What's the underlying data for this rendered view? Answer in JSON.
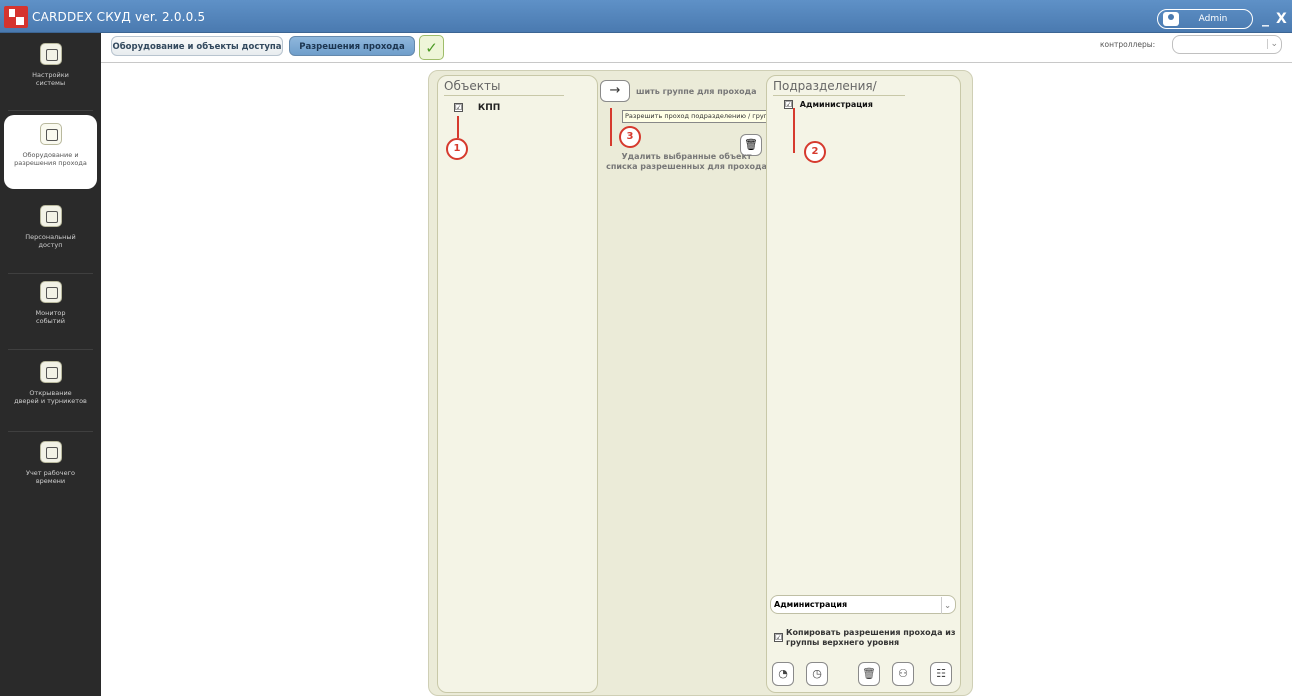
{
  "titlebar": {
    "title": "CARDDEX СКУД ver. 2.0.0.5",
    "user": "Admin",
    "minimize": "_",
    "close": "X"
  },
  "sidebar": {
    "items": [
      {
        "label": "Настройки\nсистемы",
        "icon": "settings-icon"
      },
      {
        "label": "Оборудование и\nразрешения прохода",
        "icon": "equipment-icon",
        "active": true
      },
      {
        "label": "Персональный\nдоступ",
        "icon": "personal-access-icon"
      },
      {
        "label": "Монитор\nсобытий",
        "icon": "monitor-icon"
      },
      {
        "label": "Открывание\nдверей и турникетов",
        "icon": "door-icon"
      },
      {
        "label": "Учет рабочего\nвремени",
        "icon": "worktime-icon"
      }
    ]
  },
  "tabs": [
    {
      "label": "Оборудование и объекты доступа",
      "active": false
    },
    {
      "label": "Разрешения прохода",
      "active": true
    }
  ],
  "apply_symbol": "✓",
  "controllers": {
    "label": "контроллеры:",
    "value": ""
  },
  "objects": {
    "title": "Объекты",
    "items": [
      {
        "label": "КПП",
        "checked": true
      }
    ]
  },
  "middle": {
    "arrow_symbol": "→",
    "add_text": "шить группе для прохода",
    "tooltip": "Разрешить проход подразделению / группе людей через выбранные зоны прохода",
    "remove_text": "Удалить выбранные объект\nсписка разрешенных для прохода"
  },
  "departments": {
    "title": "Подразделения/",
    "items": [
      {
        "label": "Администрация",
        "checked": true
      }
    ],
    "select_value": "Администрация",
    "copy_label": "Копировать разрешения прохода из группы верхнего уровня",
    "copy_checked": true
  },
  "annotations": [
    "1",
    "2",
    "3"
  ],
  "colors": {
    "accent": "#4a7ab0",
    "annotation": "#d63a2e",
    "panel": "#ebebd8"
  }
}
